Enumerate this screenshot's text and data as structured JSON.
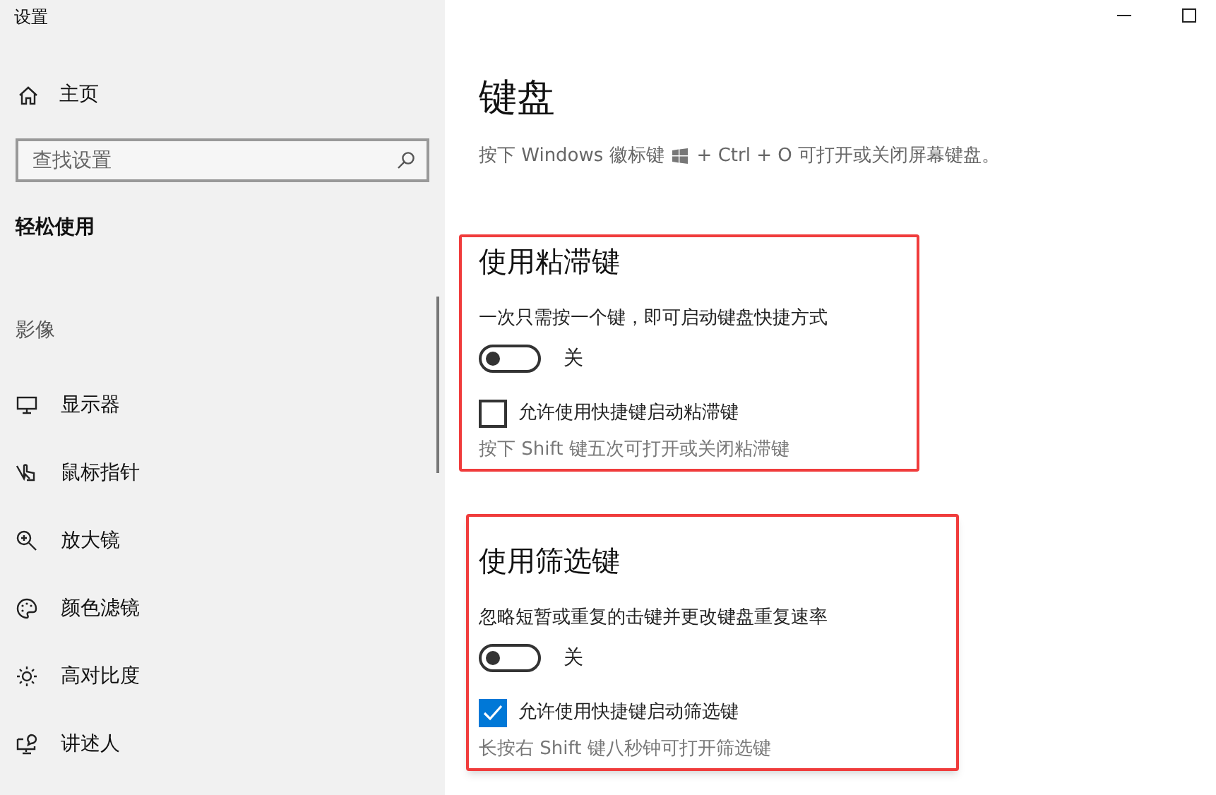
{
  "window": {
    "title": "设置"
  },
  "sidebar": {
    "home": "主页",
    "search": {
      "placeholder": "查找设置"
    },
    "section": "轻松使用",
    "category": "影像",
    "items": [
      {
        "label": "显示器"
      },
      {
        "label": "鼠标指针"
      },
      {
        "label": "放大镜"
      },
      {
        "label": "颜色滤镜"
      },
      {
        "label": "高对比度"
      },
      {
        "label": "讲述人"
      }
    ]
  },
  "page": {
    "title": "键盘",
    "hint_before": "按下 Windows 徽标键",
    "hint_after": "+ Ctrl + O 可打开或关闭屏幕键盘。",
    "groups": [
      {
        "title": "使用粘滞键",
        "description": "一次只需按一个键，即可启动键盘快捷方式",
        "toggle": {
          "on": false,
          "label": "关"
        },
        "checkbox": {
          "checked": false,
          "label": "允许使用快捷键启动粘滞键"
        },
        "note": "按下 Shift 键五次可打开或关闭粘滞键"
      },
      {
        "title": "使用筛选键",
        "description": "忽略短暂或重复的击键并更改键盘重复速率",
        "toggle": {
          "on": false,
          "label": "关"
        },
        "checkbox": {
          "checked": true,
          "label": "允许使用快捷键启动筛选键"
        },
        "note": "长按右 Shift 键八秒钟可打开筛选键"
      }
    ]
  }
}
